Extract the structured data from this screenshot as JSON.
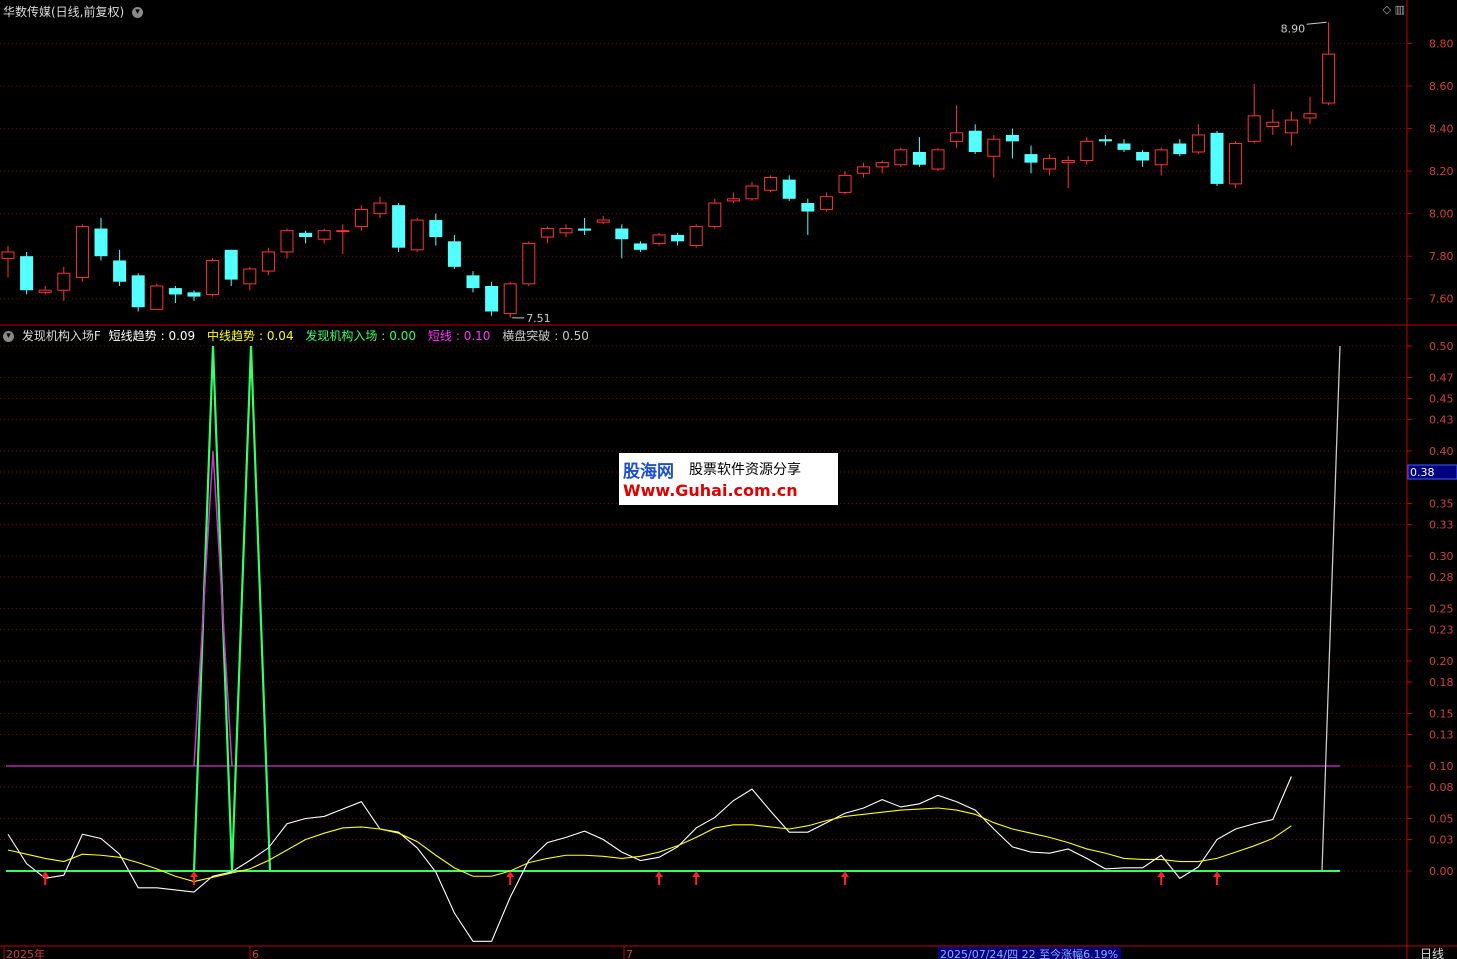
{
  "main": {
    "title": "华数传媒(日线,前复权)",
    "price_axis": [
      "8.80",
      "8.60",
      "8.40",
      "8.20",
      "8.00",
      "7.80",
      "7.60"
    ],
    "high_label": "8.90",
    "low_label": "7.51",
    "icons": [
      "diamond-icon",
      "window-icon"
    ]
  },
  "indicator": {
    "name": "发现机构入场F",
    "legend": [
      {
        "label": "短线趋势",
        "value": "0.09",
        "color": "#ffffff"
      },
      {
        "label": "中线趋势",
        "value": "0.04",
        "color": "#ffff00"
      },
      {
        "label": "发现机构入场",
        "value": "0.00",
        "color": "#33ff66"
      },
      {
        "label": "短线",
        "value": "0.10",
        "color": "#ff33ff"
      },
      {
        "label": "横盘突破",
        "value": "0.50",
        "color": "#c8c8c8"
      }
    ],
    "axis_ticks": [
      "0.50",
      "0.47",
      "0.45",
      "0.43",
      "0.40",
      "0.38",
      "0.35",
      "0.33",
      "0.30",
      "0.28",
      "0.25",
      "0.23",
      "0.20",
      "0.18",
      "0.15",
      "0.13",
      "0.10",
      "0.08",
      "0.05",
      "0.03",
      "0.00"
    ],
    "cursor_value": "0.38"
  },
  "watermark": {
    "brand": "股海网",
    "slogan": "股票软件资源分享",
    "url": "Www.Guhai.com.cn"
  },
  "footer": {
    "labels": [
      "2025年",
      "6",
      "7"
    ],
    "status": "2025/07/24/四 22 至今涨幅6.19%",
    "period": "日线"
  },
  "colors": {
    "up": "#ff3232",
    "down": "#54ffff",
    "grid": "#7a0000",
    "axis": "#c00000"
  },
  "chart_data": [
    {
      "type": "candlestick",
      "title": "华数传媒(日线,前复权)",
      "ylim": [
        7.5,
        8.92
      ],
      "candles": [
        [
          7.79,
          7.82,
          7.85,
          7.7
        ],
        [
          7.8,
          7.64,
          7.82,
          7.62
        ],
        [
          7.63,
          7.64,
          7.66,
          7.62
        ],
        [
          7.64,
          7.72,
          7.75,
          7.59
        ],
        [
          7.7,
          7.94,
          7.95,
          7.68
        ],
        [
          7.93,
          7.8,
          7.98,
          7.78
        ],
        [
          7.78,
          7.68,
          7.83,
          7.66
        ],
        [
          7.71,
          7.56,
          7.72,
          7.54
        ],
        [
          7.55,
          7.66,
          7.67,
          7.55
        ],
        [
          7.65,
          7.62,
          7.66,
          7.58
        ],
        [
          7.63,
          7.61,
          7.64,
          7.59
        ],
        [
          7.62,
          7.78,
          7.79,
          7.61
        ],
        [
          7.83,
          7.69,
          7.83,
          7.66
        ],
        [
          7.67,
          7.74,
          7.75,
          7.64
        ],
        [
          7.73,
          7.82,
          7.84,
          7.71
        ],
        [
          7.82,
          7.92,
          7.93,
          7.79
        ],
        [
          7.91,
          7.89,
          7.92,
          7.86
        ],
        [
          7.88,
          7.92,
          7.93,
          7.86
        ],
        [
          7.92,
          7.92,
          7.95,
          7.81
        ],
        [
          7.94,
          8.02,
          8.04,
          7.92
        ],
        [
          8.0,
          8.05,
          8.08,
          7.98
        ],
        [
          8.04,
          7.84,
          8.05,
          7.82
        ],
        [
          7.83,
          7.97,
          7.98,
          7.82
        ],
        [
          7.97,
          7.89,
          8.0,
          7.85
        ],
        [
          7.87,
          7.75,
          7.9,
          7.74
        ],
        [
          7.71,
          7.65,
          7.73,
          7.63
        ],
        [
          7.66,
          7.54,
          7.68,
          7.52
        ],
        [
          7.53,
          7.67,
          7.68,
          7.51
        ],
        [
          7.67,
          7.86,
          7.87,
          7.66
        ],
        [
          7.89,
          7.93,
          7.94,
          7.86
        ],
        [
          7.91,
          7.93,
          7.95,
          7.89
        ],
        [
          7.93,
          7.92,
          7.98,
          7.9
        ],
        [
          7.96,
          7.97,
          7.99,
          7.95
        ],
        [
          7.93,
          7.88,
          7.95,
          7.79
        ],
        [
          7.86,
          7.83,
          7.87,
          7.82
        ],
        [
          7.86,
          7.9,
          7.91,
          7.85
        ],
        [
          7.9,
          7.87,
          7.91,
          7.85
        ],
        [
          7.85,
          7.94,
          7.95,
          7.84
        ],
        [
          7.94,
          8.05,
          8.07,
          7.93
        ],
        [
          8.06,
          8.07,
          8.1,
          8.05
        ],
        [
          8.07,
          8.13,
          8.15,
          8.06
        ],
        [
          8.11,
          8.17,
          8.18,
          8.1
        ],
        [
          8.16,
          8.07,
          8.18,
          8.06
        ],
        [
          8.05,
          8.01,
          8.07,
          7.9
        ],
        [
          8.02,
          8.08,
          8.1,
          8.01
        ],
        [
          8.1,
          8.18,
          8.2,
          8.09
        ],
        [
          8.19,
          8.22,
          8.24,
          8.17
        ],
        [
          8.22,
          8.24,
          8.25,
          8.19
        ],
        [
          8.23,
          8.3,
          8.31,
          8.22
        ],
        [
          8.29,
          8.23,
          8.36,
          8.22
        ],
        [
          8.21,
          8.3,
          8.31,
          8.2
        ],
        [
          8.34,
          8.38,
          8.51,
          8.31
        ],
        [
          8.39,
          8.29,
          8.42,
          8.28
        ],
        [
          8.27,
          8.35,
          8.37,
          8.17
        ],
        [
          8.37,
          8.34,
          8.4,
          8.26
        ],
        [
          8.28,
          8.24,
          8.32,
          8.19
        ],
        [
          8.21,
          8.26,
          8.28,
          8.18
        ],
        [
          8.24,
          8.25,
          8.27,
          8.12
        ],
        [
          8.25,
          8.34,
          8.36,
          8.23
        ],
        [
          8.35,
          8.34,
          8.37,
          8.32
        ],
        [
          8.33,
          8.3,
          8.35,
          8.29
        ],
        [
          8.29,
          8.25,
          8.3,
          8.22
        ],
        [
          8.23,
          8.3,
          8.31,
          8.18
        ],
        [
          8.33,
          8.28,
          8.35,
          8.27
        ],
        [
          8.29,
          8.37,
          8.42,
          8.28
        ],
        [
          8.38,
          8.14,
          8.39,
          8.13
        ],
        [
          8.14,
          8.33,
          8.34,
          8.12
        ],
        [
          8.34,
          8.46,
          8.61,
          8.33
        ],
        [
          8.41,
          8.43,
          8.49,
          8.37
        ],
        [
          8.38,
          8.44,
          8.48,
          8.32
        ],
        [
          8.45,
          8.47,
          8.55,
          8.42
        ],
        [
          8.52,
          8.75,
          8.9,
          8.51
        ]
      ]
    },
    {
      "type": "line",
      "title": "发现机构入场F",
      "ylim": [
        0,
        0.5
      ],
      "series": [
        {
          "name": "短线趋势",
          "color": "#ffffff",
          "values": [
            0.035,
            0.007,
            -0.007,
            -0.004,
            0.035,
            0.031,
            0.016,
            -0.016,
            -0.016,
            -0.018,
            -0.02,
            -0.005,
            -0.001,
            0.01,
            0.022,
            0.045,
            0.05,
            0.052,
            0.059,
            0.066,
            0.04,
            0.037,
            0.022,
            -0.001,
            -0.04,
            -0.067,
            -0.067,
            -0.025,
            0.01,
            0.027,
            0.032,
            0.038,
            0.03,
            0.018,
            0.01,
            0.013,
            0.023,
            0.041,
            0.051,
            0.067,
            0.078,
            0.057,
            0.037,
            0.037,
            0.046,
            0.055,
            0.06,
            0.068,
            0.061,
            0.064,
            0.072,
            0.066,
            0.058,
            0.04,
            0.023,
            0.018,
            0.017,
            0.021,
            0.012,
            0.002,
            0.003,
            0.003,
            0.015,
            -0.007,
            0.004,
            0.03,
            0.04,
            0.045,
            0.049,
            0.09
          ]
        },
        {
          "name": "中线趋势",
          "color": "#ffff00",
          "values": [
            0.02,
            0.016,
            0.012,
            0.009,
            0.016,
            0.015,
            0.013,
            0.008,
            0.002,
            -0.005,
            -0.01,
            -0.006,
            -0.002,
            0.002,
            0.01,
            0.02,
            0.03,
            0.036,
            0.041,
            0.042,
            0.04,
            0.036,
            0.028,
            0.015,
            0.003,
            -0.005,
            -0.005,
            0.0,
            0.008,
            0.012,
            0.015,
            0.015,
            0.014,
            0.012,
            0.014,
            0.018,
            0.024,
            0.032,
            0.041,
            0.044,
            0.044,
            0.042,
            0.04,
            0.043,
            0.048,
            0.052,
            0.054,
            0.056,
            0.058,
            0.059,
            0.06,
            0.058,
            0.054,
            0.046,
            0.04,
            0.036,
            0.032,
            0.027,
            0.021,
            0.017,
            0.012,
            0.011,
            0.011,
            0.009,
            0.009,
            0.012,
            0.018,
            0.024,
            0.031,
            0.043
          ]
        },
        {
          "name": "短线",
          "color": "#ff33ff",
          "values": [
            0.1,
            0.1,
            0.1,
            0.1,
            0.1,
            0.1,
            0.1,
            0.1,
            0.1,
            0.1,
            0.1,
            0.1,
            0.1,
            0.1,
            0.1,
            0.1,
            0.1,
            0.1,
            0.1,
            0.1,
            0.1,
            0.1,
            0.1,
            0.1,
            0.1,
            0.1,
            0.1,
            0.1,
            0.1,
            0.1,
            0.1,
            0.1,
            0.1,
            0.1,
            0.1,
            0.1,
            0.1,
            0.1,
            0.1,
            0.1,
            0.1,
            0.1,
            0.1,
            0.1,
            0.1,
            0.1,
            0.1,
            0.1,
            0.1,
            0.1,
            0.1,
            0.1,
            0.1,
            0.1,
            0.1,
            0.1,
            0.1,
            0.1,
            0.1,
            0.1,
            0.1,
            0.1,
            0.1,
            0.1,
            0.1,
            0.1,
            0.1,
            0.1,
            0.1,
            0.1
          ]
        }
      ],
      "entry_spikes": [
        {
          "name": "发现机构入场",
          "color": "#33ff66",
          "peaks": [
            {
              "start": 0.0,
              "up": "spike"
            }
          ]
        }
      ],
      "horizontal_lines": [
        {
          "value": 0.0,
          "color": "#33ff66"
        },
        {
          "value": 0.1,
          "color": "#cc33cc"
        }
      ],
      "arrows_at_index": [
        2,
        10,
        27,
        35,
        37,
        45,
        62,
        65
      ]
    }
  ]
}
